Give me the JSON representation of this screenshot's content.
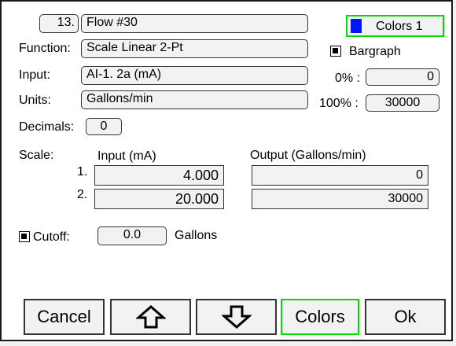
{
  "header": {
    "item_number": "13.",
    "name": "Flow #30",
    "colors_label": "Colors 1",
    "colors_swatch": "#0015ff"
  },
  "function": {
    "label": "Function:",
    "value": "Scale Linear 2-Pt"
  },
  "input": {
    "label": "Input:",
    "value": "AI-1. 2a (mA)"
  },
  "units": {
    "label": "Units:",
    "value": "Gallons/min"
  },
  "bargraph": {
    "label": "Bargraph",
    "checked": true
  },
  "range": {
    "low_label": "0% :",
    "low_value": "0",
    "high_label": "100% :",
    "high_value": "30000"
  },
  "decimals": {
    "label": "Decimals:",
    "value": "0"
  },
  "scale": {
    "label": "Scale:",
    "input_header": "Input (mA)",
    "output_header": "Output (Gallons/min)",
    "rows": [
      {
        "index": "1.",
        "input": "4.000",
        "output": "0"
      },
      {
        "index": "2.",
        "input": "20.000",
        "output": "30000"
      }
    ]
  },
  "cutoff": {
    "label": "Cutoff:",
    "value": "0.0",
    "unit": "Gallons",
    "checked": true
  },
  "buttons": {
    "cancel": "Cancel",
    "up_icon": "up-arrow-icon",
    "down_icon": "down-arrow-icon",
    "colors": "Colors",
    "ok": "Ok"
  },
  "colors": {
    "highlight_border": "#00dd00",
    "field_bg": "#f2f2f2"
  }
}
